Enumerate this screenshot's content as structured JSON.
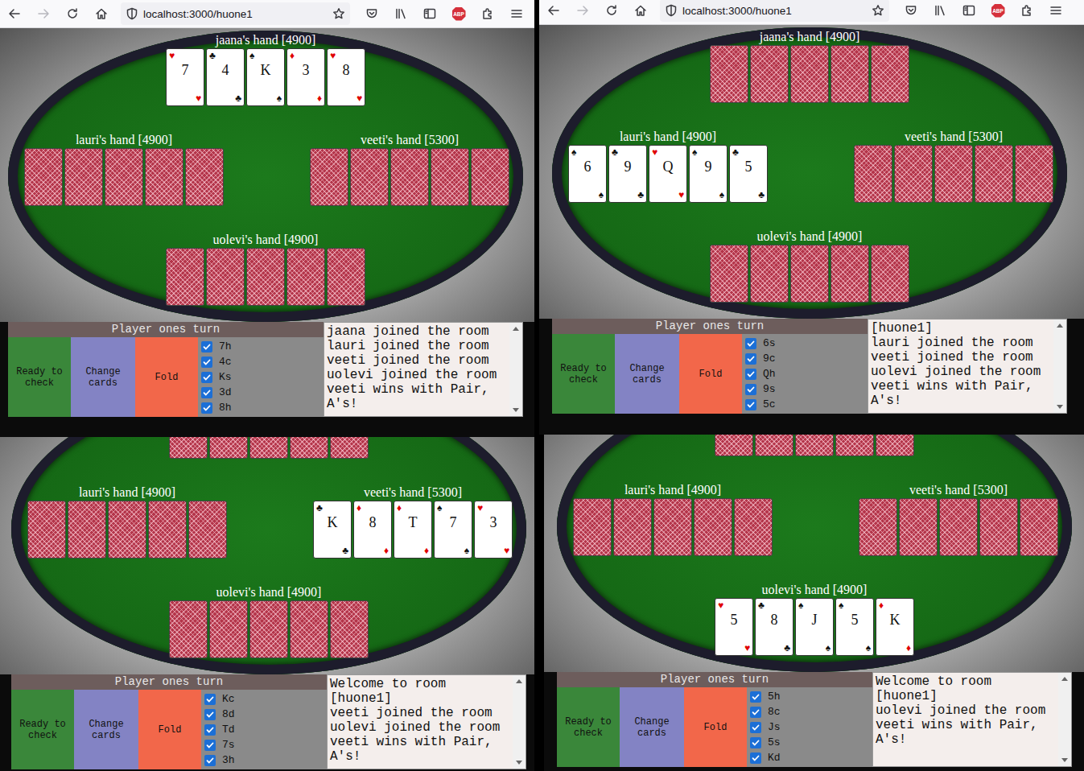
{
  "windows": [
    {
      "toolbar": {
        "url": "localhost:3000/huone1",
        "forward_enabled": false,
        "adblock_label": "ABP"
      },
      "hands": [
        {
          "label": "jaana's hand [4900]",
          "cards": [
            {
              "face_up": true,
              "rank": "7",
              "suit": "♥",
              "color": "#e00000"
            },
            {
              "face_up": true,
              "rank": "4",
              "suit": "♣",
              "color": "#111111"
            },
            {
              "face_up": true,
              "rank": "K",
              "suit": "♠",
              "color": "#111111"
            },
            {
              "face_up": true,
              "rank": "3",
              "suit": "♦",
              "color": "#e00000"
            },
            {
              "face_up": true,
              "rank": "8",
              "suit": "♥",
              "color": "#e00000"
            }
          ]
        },
        {
          "label": "lauri's hand [4900]",
          "cards": [
            {
              "face_up": false
            },
            {
              "face_up": false
            },
            {
              "face_up": false
            },
            {
              "face_up": false
            },
            {
              "face_up": false
            }
          ]
        },
        {
          "label": "veeti's hand [5300]",
          "cards": [
            {
              "face_up": false
            },
            {
              "face_up": false
            },
            {
              "face_up": false
            },
            {
              "face_up": false
            },
            {
              "face_up": false
            }
          ]
        },
        {
          "label": "uolevi's hand [4900]",
          "cards": [
            {
              "face_up": false
            },
            {
              "face_up": false
            },
            {
              "face_up": false
            },
            {
              "face_up": false
            },
            {
              "face_up": false
            }
          ]
        }
      ],
      "status": "Player ones turn",
      "buttons": [
        {
          "label": "Ready to check",
          "color": "#3a873a"
        },
        {
          "label": "Change cards",
          "color": "#8383c4"
        },
        {
          "label": "Fold",
          "color": "#f2674a"
        }
      ],
      "selection": [
        {
          "label": "7h",
          "checked": true
        },
        {
          "label": "4c",
          "checked": true
        },
        {
          "label": "Ks",
          "checked": true
        },
        {
          "label": "3d",
          "checked": true
        },
        {
          "label": "8h",
          "checked": true
        }
      ],
      "log": [
        "jaana joined the room",
        "lauri joined the room",
        "veeti joined the room",
        "uolevi joined the room",
        "veeti wins with Pair, A's!"
      ]
    },
    {
      "toolbar": {
        "url": "localhost:3000/huone1",
        "forward_enabled": false,
        "adblock_label": "ABP"
      },
      "hands": [
        {
          "label": "jaana's hand [4900]",
          "cards": [
            {
              "face_up": false
            },
            {
              "face_up": false
            },
            {
              "face_up": false
            },
            {
              "face_up": false
            },
            {
              "face_up": false
            }
          ]
        },
        {
          "label": "lauri's hand [4900]",
          "cards": [
            {
              "face_up": true,
              "rank": "6",
              "suit": "♠",
              "color": "#111111"
            },
            {
              "face_up": true,
              "rank": "9",
              "suit": "♣",
              "color": "#111111"
            },
            {
              "face_up": true,
              "rank": "Q",
              "suit": "♥",
              "color": "#e00000"
            },
            {
              "face_up": true,
              "rank": "9",
              "suit": "♠",
              "color": "#111111"
            },
            {
              "face_up": true,
              "rank": "5",
              "suit": "♣",
              "color": "#111111"
            }
          ]
        },
        {
          "label": "veeti's hand [5300]",
          "cards": [
            {
              "face_up": false
            },
            {
              "face_up": false
            },
            {
              "face_up": false
            },
            {
              "face_up": false
            },
            {
              "face_up": false
            }
          ]
        },
        {
          "label": "uolevi's hand [4900]",
          "cards": [
            {
              "face_up": false
            },
            {
              "face_up": false
            },
            {
              "face_up": false
            },
            {
              "face_up": false
            },
            {
              "face_up": false
            }
          ]
        }
      ],
      "status": "Player ones turn",
      "buttons": [
        {
          "label": "Ready to check",
          "color": "#3a873a"
        },
        {
          "label": "Change cards",
          "color": "#8383c4"
        },
        {
          "label": "Fold",
          "color": "#f2674a"
        }
      ],
      "selection": [
        {
          "label": "6s",
          "checked": true
        },
        {
          "label": "9c",
          "checked": true
        },
        {
          "label": "Qh",
          "checked": true
        },
        {
          "label": "9s",
          "checked": true
        },
        {
          "label": "5c",
          "checked": true
        }
      ],
      "log": [
        "[huone1]",
        "lauri joined the room",
        "veeti joined the room",
        "uolevi joined the room",
        "veeti wins with Pair, A's!"
      ]
    },
    {
      "hands": [
        {
          "cards": [
            {
              "face_up": false
            },
            {
              "face_up": false
            },
            {
              "face_up": false
            },
            {
              "face_up": false
            },
            {
              "face_up": false
            }
          ]
        },
        {
          "label": "lauri's hand [4900]",
          "cards": [
            {
              "face_up": false
            },
            {
              "face_up": false
            },
            {
              "face_up": false
            },
            {
              "face_up": false
            },
            {
              "face_up": false
            }
          ]
        },
        {
          "label": "veeti's hand [5300]",
          "cards": [
            {
              "face_up": true,
              "rank": "K",
              "suit": "♣",
              "color": "#111111"
            },
            {
              "face_up": true,
              "rank": "8",
              "suit": "♦",
              "color": "#e00000"
            },
            {
              "face_up": true,
              "rank": "T",
              "suit": "♦",
              "color": "#e00000"
            },
            {
              "face_up": true,
              "rank": "7",
              "suit": "♠",
              "color": "#111111"
            },
            {
              "face_up": true,
              "rank": "3",
              "suit": "♥",
              "color": "#e00000"
            }
          ]
        },
        {
          "label": "uolevi's hand [4900]",
          "cards": [
            {
              "face_up": false
            },
            {
              "face_up": false
            },
            {
              "face_up": false
            },
            {
              "face_up": false
            },
            {
              "face_up": false
            }
          ]
        }
      ],
      "status": "Player ones turn",
      "buttons": [
        {
          "label": "Ready to check",
          "color": "#3a873a"
        },
        {
          "label": "Change cards",
          "color": "#8383c4"
        },
        {
          "label": "Fold",
          "color": "#f2674a"
        }
      ],
      "selection": [
        {
          "label": "Kc",
          "checked": true
        },
        {
          "label": "8d",
          "checked": true
        },
        {
          "label": "Td",
          "checked": true
        },
        {
          "label": "7s",
          "checked": true
        },
        {
          "label": "3h",
          "checked": true
        }
      ],
      "log": [
        "Welcome to room [huone1]",
        "veeti joined the room",
        "uolevi joined the room",
        "veeti wins with Pair, A's!"
      ]
    },
    {
      "hands": [
        {
          "cards": [
            {
              "face_up": false
            },
            {
              "face_up": false
            },
            {
              "face_up": false
            },
            {
              "face_up": false
            },
            {
              "face_up": false
            }
          ]
        },
        {
          "label": "lauri's hand [4900]",
          "cards": [
            {
              "face_up": false
            },
            {
              "face_up": false
            },
            {
              "face_up": false
            },
            {
              "face_up": false
            },
            {
              "face_up": false
            }
          ]
        },
        {
          "label": "veeti's hand [5300]",
          "cards": [
            {
              "face_up": false
            },
            {
              "face_up": false
            },
            {
              "face_up": false
            },
            {
              "face_up": false
            },
            {
              "face_up": false
            }
          ]
        },
        {
          "label": "uolevi's hand [4900]",
          "cards": [
            {
              "face_up": true,
              "rank": "5",
              "suit": "♥",
              "color": "#e00000"
            },
            {
              "face_up": true,
              "rank": "8",
              "suit": "♣",
              "color": "#111111"
            },
            {
              "face_up": true,
              "rank": "J",
              "suit": "♠",
              "color": "#111111"
            },
            {
              "face_up": true,
              "rank": "5",
              "suit": "♠",
              "color": "#111111"
            },
            {
              "face_up": true,
              "rank": "K",
              "suit": "♦",
              "color": "#e00000"
            }
          ]
        }
      ],
      "status": "Player ones turn",
      "buttons": [
        {
          "label": "Ready to check",
          "color": "#3a873a"
        },
        {
          "label": "Change cards",
          "color": "#8383c4"
        },
        {
          "label": "Fold",
          "color": "#f2674a"
        }
      ],
      "selection": [
        {
          "label": "5h",
          "checked": true
        },
        {
          "label": "8c",
          "checked": true
        },
        {
          "label": "Js",
          "checked": true
        },
        {
          "label": "5s",
          "checked": true
        },
        {
          "label": "Kd",
          "checked": true
        }
      ],
      "log": [
        "Welcome to room [huone1]",
        "uolevi joined the room",
        "veeti wins with Pair, A's!"
      ]
    }
  ]
}
